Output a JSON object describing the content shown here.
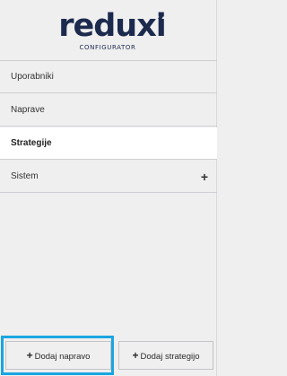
{
  "brand": {
    "name": "reduxi",
    "subtitle": "CONFIGURATOR",
    "primary_color": "#1c2a4d",
    "accent_color": "#1aa6e0"
  },
  "menu": {
    "items": [
      {
        "label": "Uporabniki",
        "active": false
      },
      {
        "label": "Naprave",
        "active": false
      },
      {
        "label": "Strategije",
        "active": true
      },
      {
        "label": "Sistem",
        "active": false,
        "expand_icon": "plus-icon",
        "expand_glyph": "+"
      }
    ]
  },
  "actions": {
    "add_device": {
      "glyph": "+",
      "label": "Dodaj napravo",
      "focused": true
    },
    "add_strategy": {
      "glyph": "+",
      "label": "Dodaj strategijo",
      "focused": false
    }
  }
}
